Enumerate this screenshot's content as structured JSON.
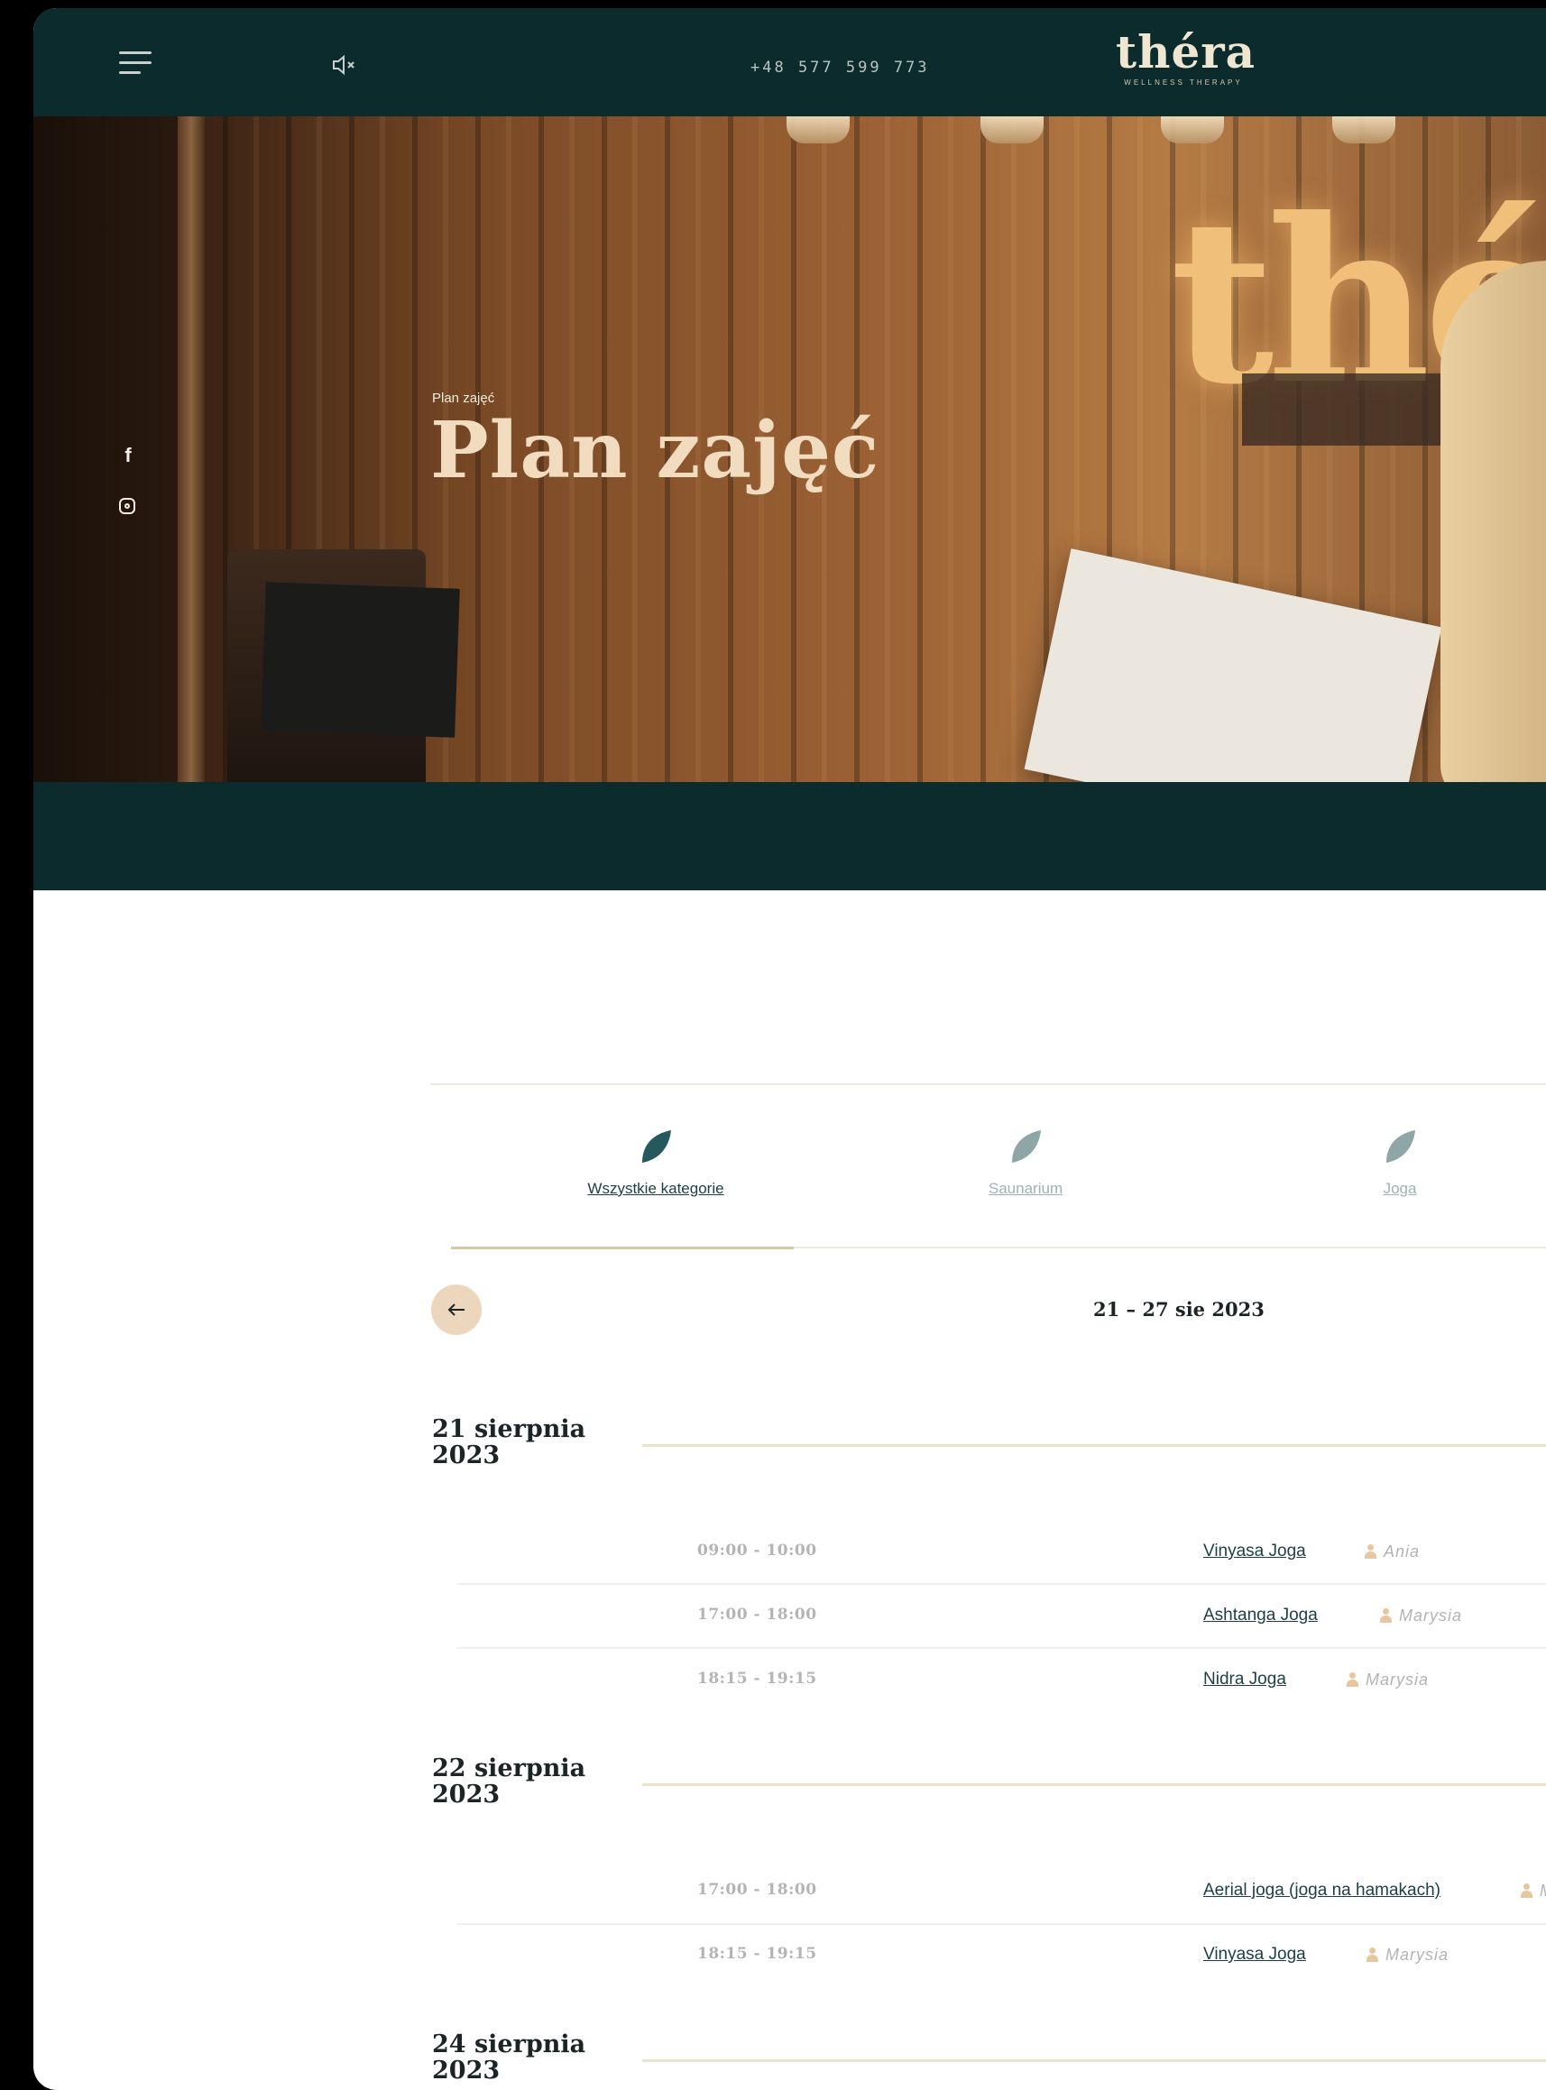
{
  "header": {
    "phone": "+48 577 599 773",
    "logo": "théra",
    "logo_tagline": "WELLNESS THERAPY"
  },
  "hero": {
    "breadcrumb": "Plan zajęć",
    "title": "Plan zajęć",
    "bg_letters": "thé",
    "social": {
      "facebook": "f"
    }
  },
  "tabs": [
    {
      "label": "Wszystkie kategorie",
      "active": true
    },
    {
      "label": "Saunarium",
      "active": false
    },
    {
      "label": "Joga",
      "active": false
    }
  ],
  "week": {
    "range": "21 – 27 sie 2023"
  },
  "days": [
    {
      "title_line1": "21 sierpnia",
      "title_line2": "2023",
      "sessions": [
        {
          "time": "09:00 - 10:00",
          "class": "Vinyasa Joga",
          "instructor": "Ania"
        },
        {
          "time": "17:00 - 18:00",
          "class": "Ashtanga Joga",
          "instructor": "Marysia"
        },
        {
          "time": "18:15 - 19:15",
          "class": "Nidra Joga",
          "instructor": "Marysia"
        }
      ]
    },
    {
      "title_line1": "22 sierpnia",
      "title_line2": "2023",
      "sessions": [
        {
          "time": "17:00 - 18:00",
          "class": "Aerial joga (joga na hamakach)",
          "instructor": "Ma"
        },
        {
          "time": "18:15 - 19:15",
          "class": "Vinyasa Joga",
          "instructor": "Marysia"
        }
      ]
    },
    {
      "title_line1": "24 sierpnia",
      "title_line2": "2023",
      "sessions": []
    }
  ],
  "colors": {
    "header_bg": "#0c2b2d",
    "accent_beige": "#ecd6bd",
    "title_cream": "#f1dcc0",
    "link_teal": "#1d3f44"
  },
  "icons": {
    "menu": "hamburger-icon",
    "sound": "speaker-muted-icon",
    "facebook": "facebook-icon",
    "instagram": "instagram-icon",
    "prev": "arrow-left-icon",
    "category": "leaf-icon",
    "instructor": "person-icon"
  }
}
